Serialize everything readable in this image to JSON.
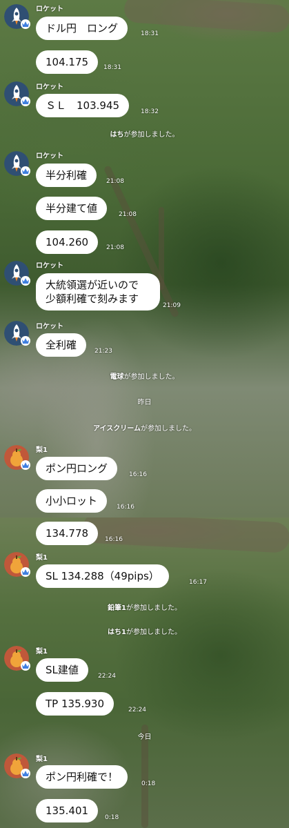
{
  "senders": {
    "rocket": "ロケット",
    "nashi": "梨1"
  },
  "messages": [
    {
      "text": "ドル円　ロング",
      "time": "18:31"
    },
    {
      "text": "104.175",
      "time": "18:31"
    },
    {
      "text": "ＳＬ　103.945",
      "time": "18:32"
    },
    {
      "text": "半分利確",
      "time": "21:08"
    },
    {
      "text": "半分建て値",
      "time": "21:08"
    },
    {
      "text": "104.260",
      "time": "21:08"
    },
    {
      "lines": [
        "大統領選が近いので",
        "少額利確で刻みます"
      ],
      "time": "21:09"
    },
    {
      "text": "全利確",
      "time": "21:23"
    },
    {
      "text": "ポン円ロング",
      "time": "16:16"
    },
    {
      "text": "小小ロット",
      "time": "16:16"
    },
    {
      "text": "134.778",
      "time": "16:16"
    },
    {
      "text": "SL  134.288（49pips）",
      "time": "16:17"
    },
    {
      "text": "SL建値",
      "time": "22:24"
    },
    {
      "text": "TP  135.930",
      "time": "22:24"
    },
    {
      "text": "ポン円利確で！",
      "time": "0:18"
    },
    {
      "text": "135.401",
      "time": "0:18"
    }
  ],
  "system": [
    {
      "user": "はち",
      "suffix": "が参加しました。"
    },
    {
      "user": "電球",
      "suffix": "が参加しました。"
    },
    {
      "user": "アイスクリーム",
      "suffix": "が参加しました。"
    },
    {
      "user": "鉛筆1",
      "suffix": "が参加しました。"
    },
    {
      "user": "はち1",
      "suffix": "が参加しました。"
    }
  ],
  "dates": {
    "yesterday": "昨日",
    "today": "今日"
  },
  "colors": {
    "rocket_avatar_bg": "#2f4f73",
    "nashi_avatar_bg": "#c0583a",
    "badge_icon": "#3f7fe0",
    "bubble": "#ffffff"
  },
  "icons": {
    "rocket_avatar": "rocket-icon",
    "nashi_avatar": "pear-icon",
    "badge": "crown-icon"
  }
}
